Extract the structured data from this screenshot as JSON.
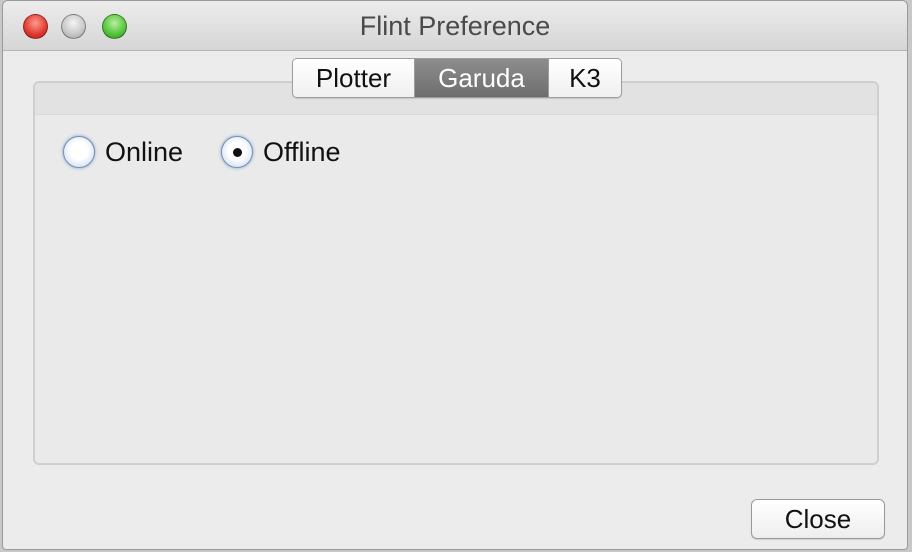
{
  "window": {
    "title": "Flint Preference",
    "controls": [
      "close",
      "minimize",
      "zoom"
    ]
  },
  "tabs": [
    {
      "label": "Plotter",
      "selected": false
    },
    {
      "label": "Garuda",
      "selected": true
    },
    {
      "label": "K3",
      "selected": false
    }
  ],
  "mode": {
    "options": [
      {
        "label": "Online",
        "checked": false
      },
      {
        "label": "Offline",
        "checked": true
      }
    ]
  },
  "footer": {
    "close_label": "Close"
  }
}
